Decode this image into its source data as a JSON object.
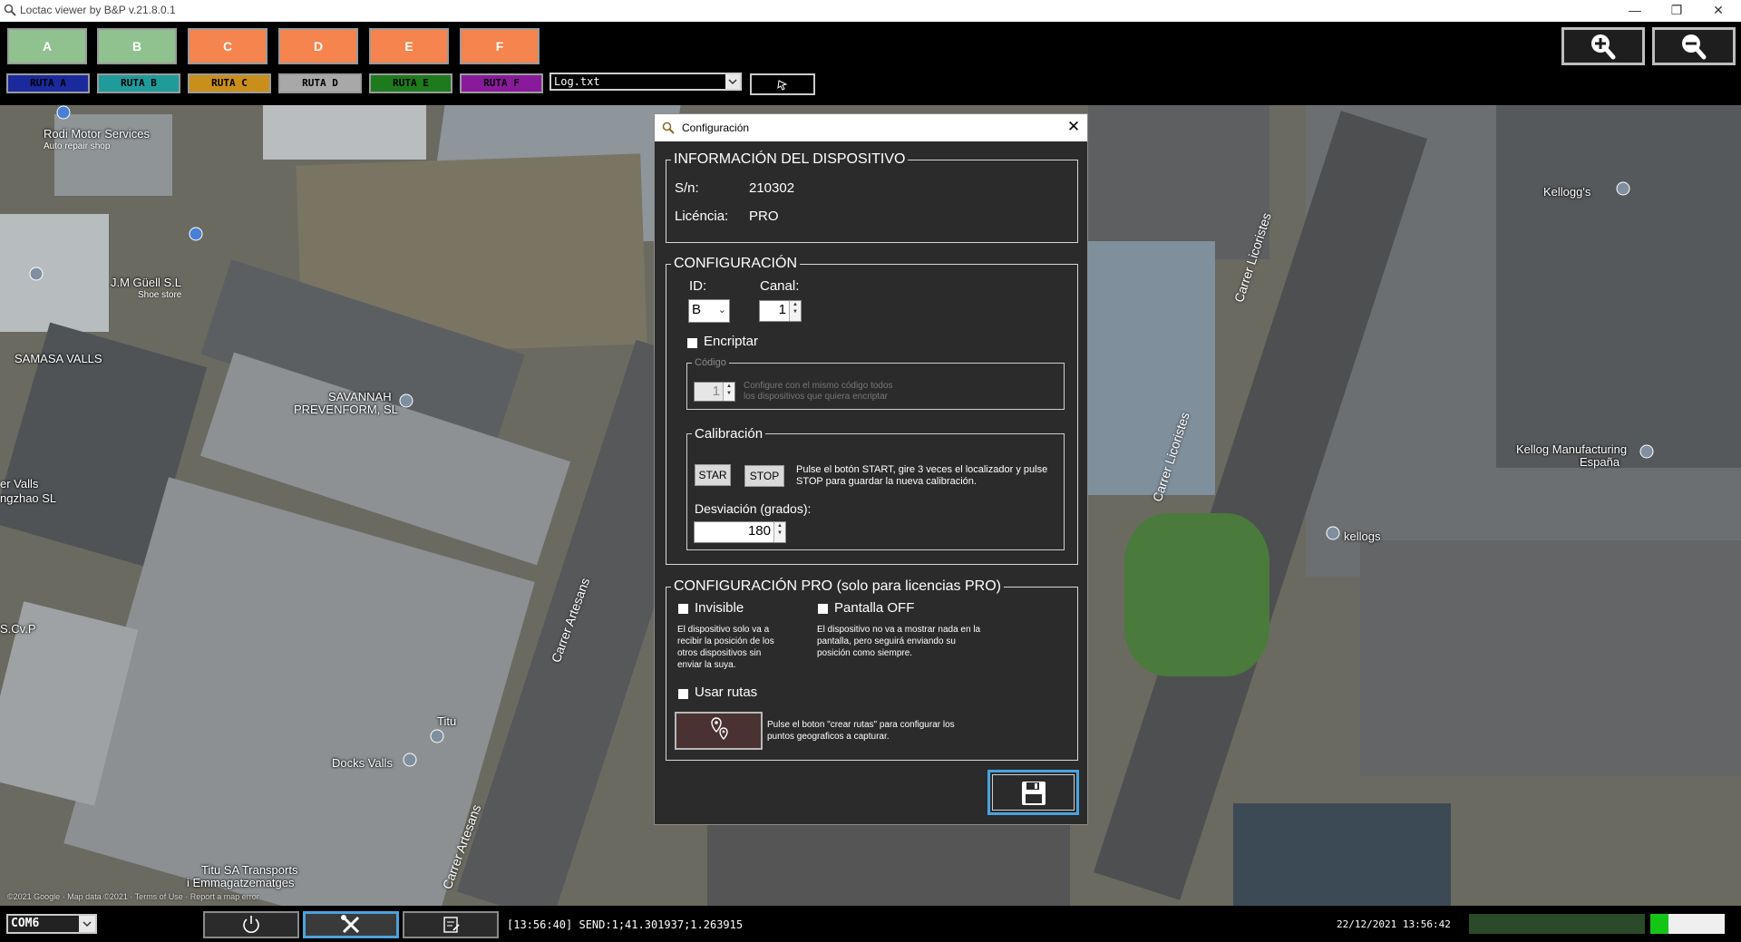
{
  "window": {
    "title": "Loctac viewer by B&P v.21.8.0.1"
  },
  "toolbar": {
    "letters": [
      {
        "label": "A",
        "color": "#8fc28f"
      },
      {
        "label": "B",
        "color": "#8fc28f"
      },
      {
        "label": "C",
        "color": "#f5844f"
      },
      {
        "label": "D",
        "color": "#f5844f"
      },
      {
        "label": "E",
        "color": "#f5844f"
      },
      {
        "label": "F",
        "color": "#f5844f"
      }
    ],
    "routes": [
      {
        "label": "RUTA A",
        "color": "#1a2a9c"
      },
      {
        "label": "RUTA B",
        "color": "#1f9b9b"
      },
      {
        "label": "RUTA C",
        "color": "#c98f1a"
      },
      {
        "label": "RUTA D",
        "color": "#a8a8a8"
      },
      {
        "label": "RUTA E",
        "color": "#1d7a1d"
      },
      {
        "label": "RUTA F",
        "color": "#8a1a9c"
      }
    ],
    "log_file": "Log.txt",
    "zoom_in_icon": "zoom-in-icon",
    "zoom_out_icon": "zoom-out-icon"
  },
  "map": {
    "labels": [
      {
        "name": "Rodi Motor Services",
        "sub": "Auto repair shop"
      },
      {
        "name": "J.M Güell S.L",
        "sub": "Shoe store"
      },
      {
        "name": "SAMASA VALLS"
      },
      {
        "name": "SAVANNAH"
      },
      {
        "name": "PREVENFORM, SL"
      },
      {
        "name": "er Valls"
      },
      {
        "name": "ngzhao SL"
      },
      {
        "name": "S.Cv.P"
      },
      {
        "name": "Titu"
      },
      {
        "name": "Docks Valls"
      },
      {
        "name": "Titu SA Transports"
      },
      {
        "name": "i Emmagatzematges"
      },
      {
        "name": "Kellogg's"
      },
      {
        "name": "Kellog Manufacturing"
      },
      {
        "name": "España"
      },
      {
        "name": "kellogs"
      }
    ],
    "streets": [
      "Carrer Artesans",
      "Carrer Artesans",
      "Carrer Licoristes",
      "Carrer Licoristes"
    ],
    "attribution": "©2021 Google · Map data ©2021 · Terms of Use · Report a map error"
  },
  "dialog": {
    "title": "Configuración",
    "device_info": {
      "legend": "INFORMACIÓN DEL DISPOSITIVO",
      "sn_label": "S/n:",
      "sn_value": "210302",
      "license_label": "Licéncia:",
      "license_value": "PRO"
    },
    "config": {
      "legend": "CONFIGURACIÓN",
      "id_label": "ID:",
      "id_value": "B",
      "channel_label": "Canal:",
      "channel_value": "1",
      "encrypt_label": "Encriptar",
      "code_legend": "Código",
      "code_value": "1",
      "code_help": "Configure con el mismo código todos los dispositivos que quiera encriptar",
      "calibration_legend": "Calibración",
      "start_label": "STAR",
      "stop_label": "STOP",
      "calibration_help": "Pulse el botón START, gire 3 veces el localizador y pulse STOP para guardar la nueva calibración.",
      "deviation_label": "Desviación (grados):",
      "deviation_value": "180"
    },
    "pro": {
      "legend": "CONFIGURACIÓN PRO (solo para licencias PRO)",
      "invisible_label": "Invisible",
      "invisible_help": "El dispositivo solo va a recibir la posición de los otros dispositivos sin enviar la suya.",
      "screen_off_label": "Pantalla OFF",
      "screen_off_help": "El dispositivo no va a mostrar nada en la pantalla, pero seguirá enviando su posición como siempre.",
      "routes_label": "Usar rutas",
      "routes_help": "Pulse el boton \"crear rutas\" para configurar los puntos geograficos a capturar.",
      "routes_icon": "map-pin-route-icon"
    },
    "save_icon": "floppy-disk-icon"
  },
  "status": {
    "port": "COM6",
    "log_line": "[13:56:40] SEND:1;41.301937;1.263915",
    "datetime": "22/12/2021 13:56:42",
    "signal_level": 0.1
  }
}
